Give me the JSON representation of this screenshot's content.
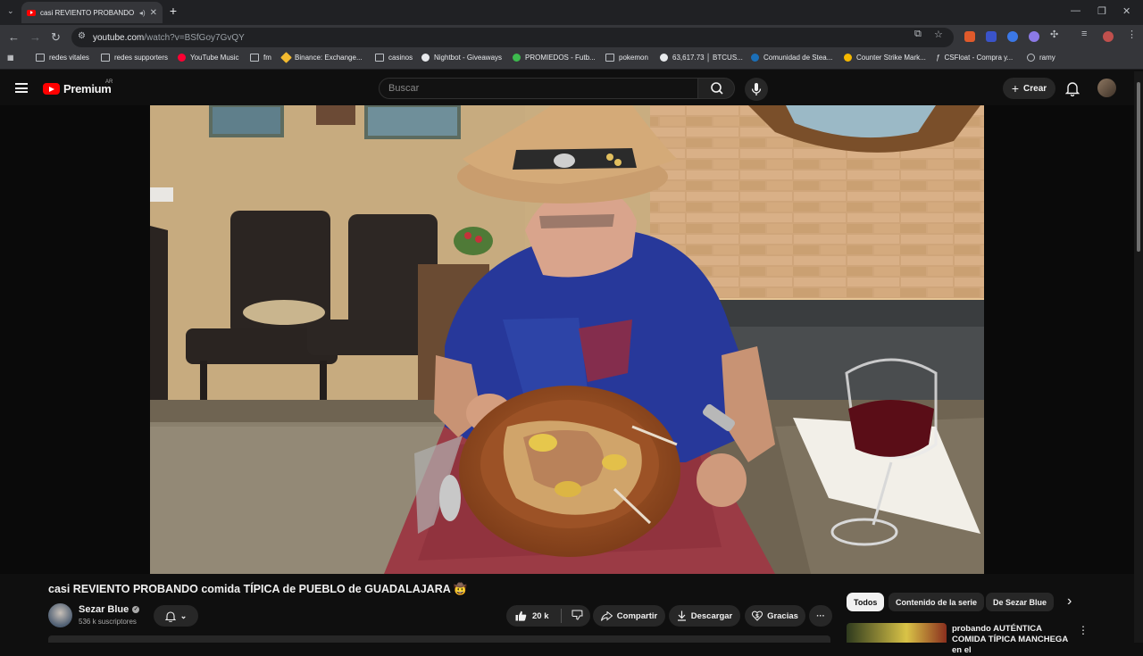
{
  "browser": {
    "tab_title": "casi REVIENTO PROBANDO",
    "tab_close": "✕",
    "new_tab": "+",
    "url_domain": "youtube.com",
    "url_path": "/watch?v=BSfGoy7GvQY",
    "bookmarks": [
      {
        "label": "redes vitales",
        "icon": "folder-icon"
      },
      {
        "label": "redes supporters",
        "icon": "folder-icon"
      },
      {
        "label": "YouTube Music",
        "icon": "youtube-music-icon"
      },
      {
        "label": "fm",
        "icon": "folder-icon"
      },
      {
        "label": "Binance: Exchange...",
        "icon": "binance-icon"
      },
      {
        "label": "casinos",
        "icon": "folder-icon"
      },
      {
        "label": "Nightbot - Giveaways",
        "icon": "nightbot-icon"
      },
      {
        "label": "PROMIEDOS - Futb...",
        "icon": "promiedos-icon"
      },
      {
        "label": "pokemon",
        "icon": "folder-icon"
      },
      {
        "label": "63,617.73 │ BTCUS...",
        "icon": "tradingview-icon"
      },
      {
        "label": "Comunidad de Stea...",
        "icon": "steam-icon"
      },
      {
        "label": "Counter Strike Mark...",
        "icon": "csmarket-icon"
      },
      {
        "label": "CSFloat - Compra y...",
        "icon": "csfloat-icon"
      },
      {
        "label": "ramy",
        "icon": "globe-icon"
      }
    ]
  },
  "youtube": {
    "logo_text": "Premium",
    "region": "AR",
    "search_placeholder": "Buscar",
    "create_label": "Crear",
    "video_title": "casi REVIENTO PROBANDO comida TÍPICA de PUEBLO de GUADALAJARA 🤠",
    "channel_name": "Sezar Blue",
    "subscribers": "536 k suscriptores",
    "likes": "20 k",
    "share_label": "Compartir",
    "download_label": "Descargar",
    "thanks_label": "Gracias",
    "more_label": "···",
    "chips": [
      "Todos",
      "Contenido de la serie",
      "De Sezar Blue"
    ],
    "next_chip": "›",
    "rec_title": "probando AUTÉNTICA COMIDA TÍPICA MANCHEGA en el"
  },
  "colors": {
    "brand": "#ff0000",
    "background": "#0f0f0f",
    "surface": "#272727"
  }
}
